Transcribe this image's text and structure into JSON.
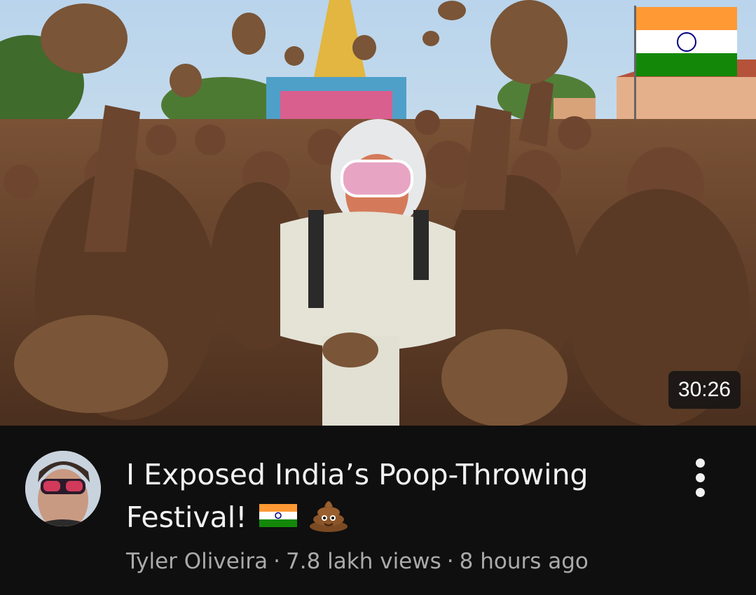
{
  "video": {
    "duration": "30:26",
    "title_line1": "I Exposed India’s Poop-Throwing",
    "title_line2": "Festival!",
    "title_emojis": [
      "india-flag-icon",
      "pile-of-poo-icon"
    ],
    "channel": "Tyler Oliveira",
    "views": "7.8 lakh views",
    "age": "8 hours ago",
    "separator": "·"
  },
  "colors": {
    "background": "#0f0f0f",
    "title": "#f1f1f1",
    "meta_text": "#aaaaaa",
    "duration_bg": "#141414"
  }
}
